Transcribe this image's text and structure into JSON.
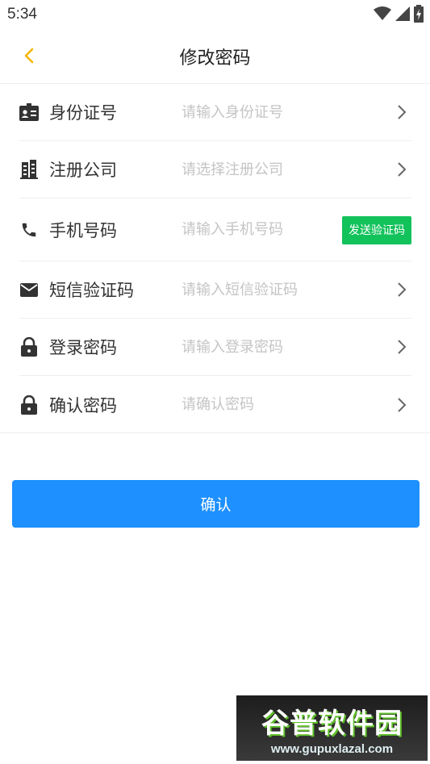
{
  "status_bar": {
    "time": "5:34"
  },
  "header": {
    "title": "修改密码"
  },
  "form": {
    "rows": [
      {
        "label": "身份证号",
        "placeholder": "请输入身份证号"
      },
      {
        "label": "注册公司",
        "placeholder": "请选择注册公司"
      },
      {
        "label": "手机号码",
        "placeholder": "请输入手机号码",
        "action": "发送验证码"
      },
      {
        "label": "短信验证码",
        "placeholder": "请输入短信验证码"
      },
      {
        "label": "登录密码",
        "placeholder": "请输入登录密码"
      },
      {
        "label": "确认密码",
        "placeholder": "请确认密码"
      }
    ]
  },
  "confirm_button": {
    "label": "确认"
  },
  "watermark": {
    "title": "谷普软件园",
    "url": "www.gupuxlazal.com"
  },
  "colors": {
    "accent": "#1e90ff",
    "sms_button": "#12c25b",
    "back_arrow": "#f5b400"
  }
}
